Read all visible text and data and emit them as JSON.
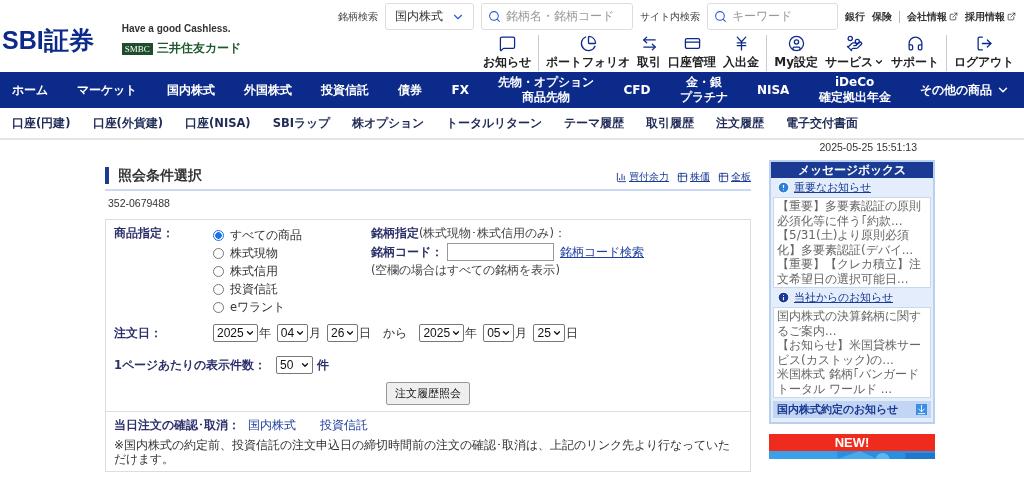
{
  "header": {
    "logo": "SBI証券",
    "tagline": "Have a good Cashless.",
    "card_badge": "SMBC",
    "card_name": "三井住友カード"
  },
  "stock_search": {
    "label": "銘柄検索",
    "market": "国内株式",
    "placeholder": "銘柄名・銘柄コード"
  },
  "site_search": {
    "label": "サイト内検索",
    "placeholder": "キーワード"
  },
  "top_links": [
    {
      "label": "銀行",
      "external": false
    },
    {
      "label": "保険",
      "external": false
    },
    {
      "label": "会社情報",
      "external": true
    },
    {
      "label": "採用情報",
      "external": true
    }
  ],
  "icon_menu": [
    [
      {
        "label": "お知らせ",
        "kind": "message",
        "dropdown": false
      }
    ],
    [
      {
        "label": "ポートフォリオ",
        "kind": "pie",
        "dropdown": false
      },
      {
        "label": "取引",
        "kind": "arrows",
        "dropdown": false
      },
      {
        "label": "口座管理",
        "kind": "card",
        "dropdown": false
      },
      {
        "label": "入出金",
        "kind": "yen",
        "dropdown": false
      }
    ],
    [
      {
        "label": "My設定",
        "kind": "user",
        "dropdown": false
      },
      {
        "label": "サービス",
        "kind": "hand",
        "dropdown": true
      },
      {
        "label": "サポート",
        "kind": "headset",
        "dropdown": false
      }
    ],
    [
      {
        "label": "ログアウト",
        "kind": "logout",
        "dropdown": false
      }
    ]
  ],
  "main_nav": [
    {
      "lines": [
        "ホーム"
      ],
      "dropdown": false
    },
    {
      "lines": [
        "マーケット"
      ],
      "dropdown": false
    },
    {
      "lines": [
        "国内株式"
      ],
      "dropdown": false
    },
    {
      "lines": [
        "外国株式"
      ],
      "dropdown": false
    },
    {
      "lines": [
        "投資信託"
      ],
      "dropdown": false
    },
    {
      "lines": [
        "債券"
      ],
      "dropdown": false
    },
    {
      "lines": [
        "FX"
      ],
      "dropdown": false
    },
    {
      "lines": [
        "先物・オプション",
        "商品先物"
      ],
      "dropdown": false
    },
    {
      "lines": [
        "CFD"
      ],
      "dropdown": false
    },
    {
      "lines": [
        "金・銀",
        "プラチナ"
      ],
      "dropdown": false
    },
    {
      "lines": [
        "NISA"
      ],
      "dropdown": false
    },
    {
      "lines": [
        "iDeCo",
        "確定拠出年金"
      ],
      "dropdown": false
    },
    {
      "lines": [
        "その他の商品"
      ],
      "dropdown": true
    }
  ],
  "sub_nav": [
    "口座(円建)",
    "口座(外貨建)",
    "口座(NISA)",
    "SBIラップ",
    "株オプション",
    "トータルリターン",
    "テーマ履歴",
    "取引履歴",
    "注文履歴",
    "電子交付書面"
  ],
  "timestamp": "2025-05-25 15:51:13",
  "page": {
    "title": "照会条件選択",
    "links": [
      {
        "label": "買付余力",
        "kind": "bars"
      },
      {
        "label": "株価",
        "kind": "table"
      },
      {
        "label": "全板",
        "kind": "table"
      }
    ],
    "account": "352-0679488"
  },
  "form": {
    "product_label": "商品指定：",
    "products": [
      {
        "label": "すべての商品",
        "selected": true
      },
      {
        "label": "株式現物",
        "selected": false
      },
      {
        "label": "株式信用",
        "selected": false
      },
      {
        "label": "投資信託",
        "selected": false
      },
      {
        "label": "eワラント",
        "selected": false
      }
    ],
    "brand_title": "**銘柄指定**(株式現物･株式信用のみ)：",
    "code_label": "銘柄コード：",
    "code_search": "銘柄コード検索",
    "code_hint": "(空欄の場合はすべての銘柄を表示)",
    "date_label": "注文日：",
    "date_from": [
      {
        "value": "2025",
        "unit": "年"
      },
      {
        "value": "04",
        "unit": "月"
      },
      {
        "value": "26",
        "unit": "日"
      }
    ],
    "date_sep": "から",
    "date_to": [
      {
        "value": "2025",
        "unit": "年"
      },
      {
        "value": "05",
        "unit": "月"
      },
      {
        "value": "25",
        "unit": "日"
      }
    ],
    "per_page_label": "1ページあたりの表示件数：",
    "per_page": "50",
    "per_page_unit": "件",
    "submit": "注文履歴照会",
    "today_label": "当日注文の確認･取消：",
    "today_links": [
      "国内株式",
      "投資信託"
    ],
    "note": "※国内株式の約定前、投資信託の注文申込日の締切時間前の注文の確認･取消は、上記のリンク先より行なっていただけます。"
  },
  "message_box": {
    "title": "メッセージボックス",
    "sections": [
      {
        "title": "重要なお知らせ",
        "kind": "alert",
        "items": [
          "【重要】多要素認証の原則必須化等に伴う｢約款...",
          "【5/31(土)より原則必須化】多要素認証(デバイ...",
          "【重要】【クレカ積立】注文希望日の選択可能日..."
        ]
      },
      {
        "title": "当社からのお知らせ",
        "kind": "info",
        "items": [
          "国内株式の決算銘柄に関するご案内...",
          "【お知らせ】米国貸株サービス(カストック)の...",
          "米国株式 銘柄｢バンガードトータル ワールド ..."
        ]
      }
    ],
    "footer": "国内株式約定のお知らせ"
  },
  "banner": {
    "label": "NEW!",
    "kind": "picture"
  }
}
